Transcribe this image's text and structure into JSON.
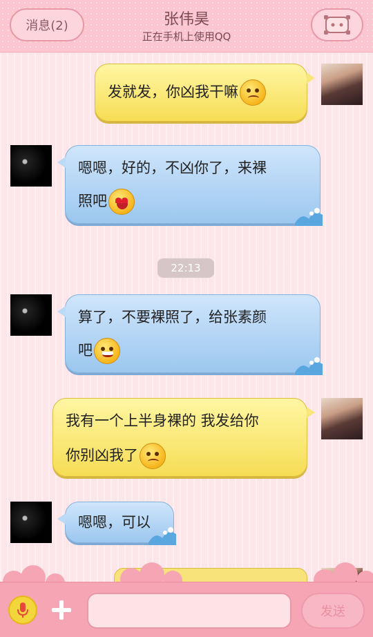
{
  "header": {
    "back_label": "消息(2)",
    "title": "张伟昊",
    "subtitle": "正在手机上使用QQ"
  },
  "messages": [
    {
      "side": "me",
      "lines": [
        "发就发，你凶我干嘛"
      ],
      "emoji": "sad-face-icon"
    },
    {
      "side": "friend",
      "lines": [
        "嗯嗯，好的，不凶你了，来裸",
        "照吧"
      ],
      "emoji": "heart-eyes-face-icon"
    },
    {
      "side": "friend",
      "lines": [
        "算了，不要裸照了，给张素颜",
        "吧"
      ],
      "emoji": "grin-face-icon"
    },
    {
      "side": "me",
      "lines": [
        "我有一个上半身裸的 我发给你",
        "你别凶我了"
      ],
      "emoji": "sad-face-icon"
    },
    {
      "side": "friend",
      "lines": [
        "嗯嗯，可以"
      ]
    }
  ],
  "timestamp": "22:13",
  "input": {
    "placeholder": "",
    "send_label": "发送"
  },
  "colors": {
    "header_bg": "#fbc6cf",
    "blue_bubble": "#9cc7ef",
    "yellow_bubble": "#f6dd55",
    "bottom_bar": "#f5a5b3"
  }
}
